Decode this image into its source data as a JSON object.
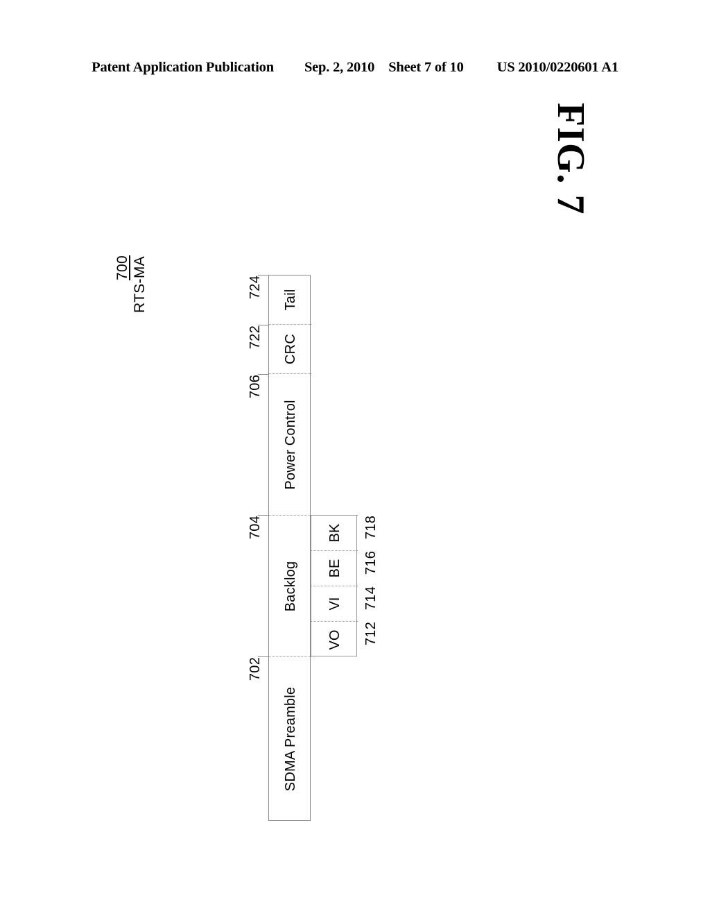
{
  "header": {
    "publication": "Patent Application Publication",
    "date": "Sep. 2, 2010",
    "sheet": "Sheet 7 of 10",
    "pub_number": "US 2010/0220601 A1"
  },
  "figure": {
    "label": "FIG. 7",
    "reference": "700",
    "title": "RTS-MA"
  },
  "frame": {
    "segments": [
      {
        "ref": "724",
        "label": "Tail"
      },
      {
        "ref": "722",
        "label": "CRC"
      },
      {
        "ref": "706",
        "label": "Power Control"
      },
      {
        "ref": "704",
        "label": "Backlog"
      },
      {
        "ref": "702",
        "label": "SDMA Preamble"
      }
    ]
  },
  "backlog_subfields": [
    {
      "ref": "718",
      "label": "BK"
    },
    {
      "ref": "716",
      "label": "BE"
    },
    {
      "ref": "714",
      "label": "VI"
    },
    {
      "ref": "712",
      "label": "VO"
    }
  ],
  "colors": {
    "ink": "#000000",
    "line": "#888888",
    "background": "#ffffff"
  }
}
